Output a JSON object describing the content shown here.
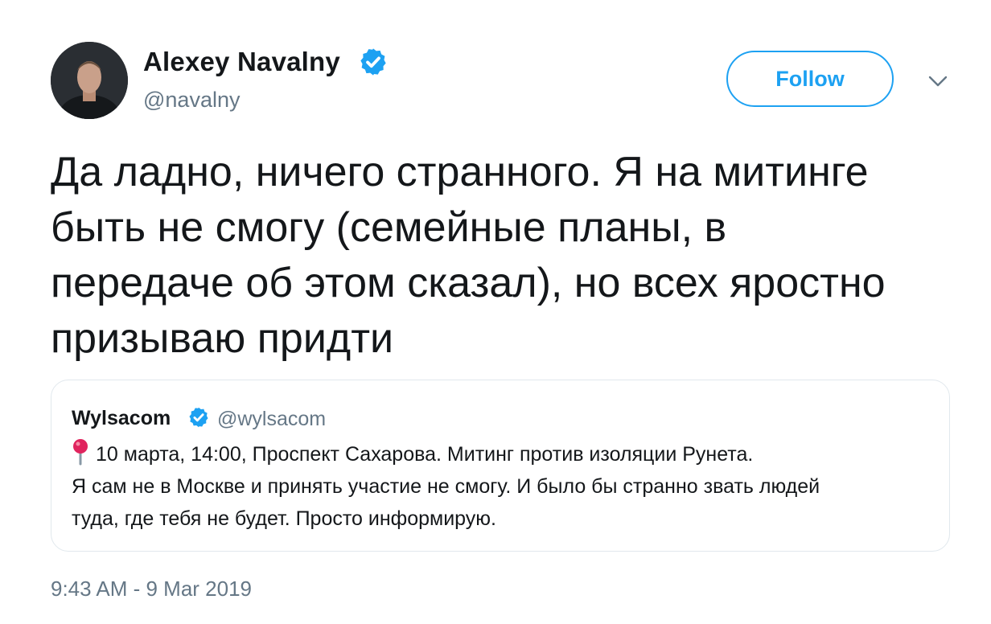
{
  "author": {
    "display_name": "Alexey Navalny",
    "handle": "@navalny",
    "verified": true
  },
  "follow_button": {
    "label": "Follow"
  },
  "icons": {
    "verified": "verified-badge-icon",
    "more": "chevron-down-icon",
    "location": "round-pushpin-icon"
  },
  "colors": {
    "accent": "#1da1f2",
    "text": "#14171a",
    "secondary_text": "#657786",
    "border": "#e1e8ed",
    "pin": "#e0245e"
  },
  "tweet": {
    "lines": [
      "Да ладно, ничего странного. Я на митинге",
      "быть не смогу (семейные планы, в",
      "передаче об этом сказал), но всех яростно",
      "призываю придти"
    ]
  },
  "quoted_tweet": {
    "display_name": "Wylsacom",
    "handle": "@wylsacom",
    "verified": true,
    "lines": [
      "10 марта, 14:00, Проспект Сахарова. Митинг против изоляции Рунета.",
      "Я сам не в Москве и принять участие не смогу. И было бы странно звать людей",
      "туда, где тебя не будет. Просто информирую."
    ]
  },
  "timestamp": "9:43 AM - 9 Mar 2019"
}
